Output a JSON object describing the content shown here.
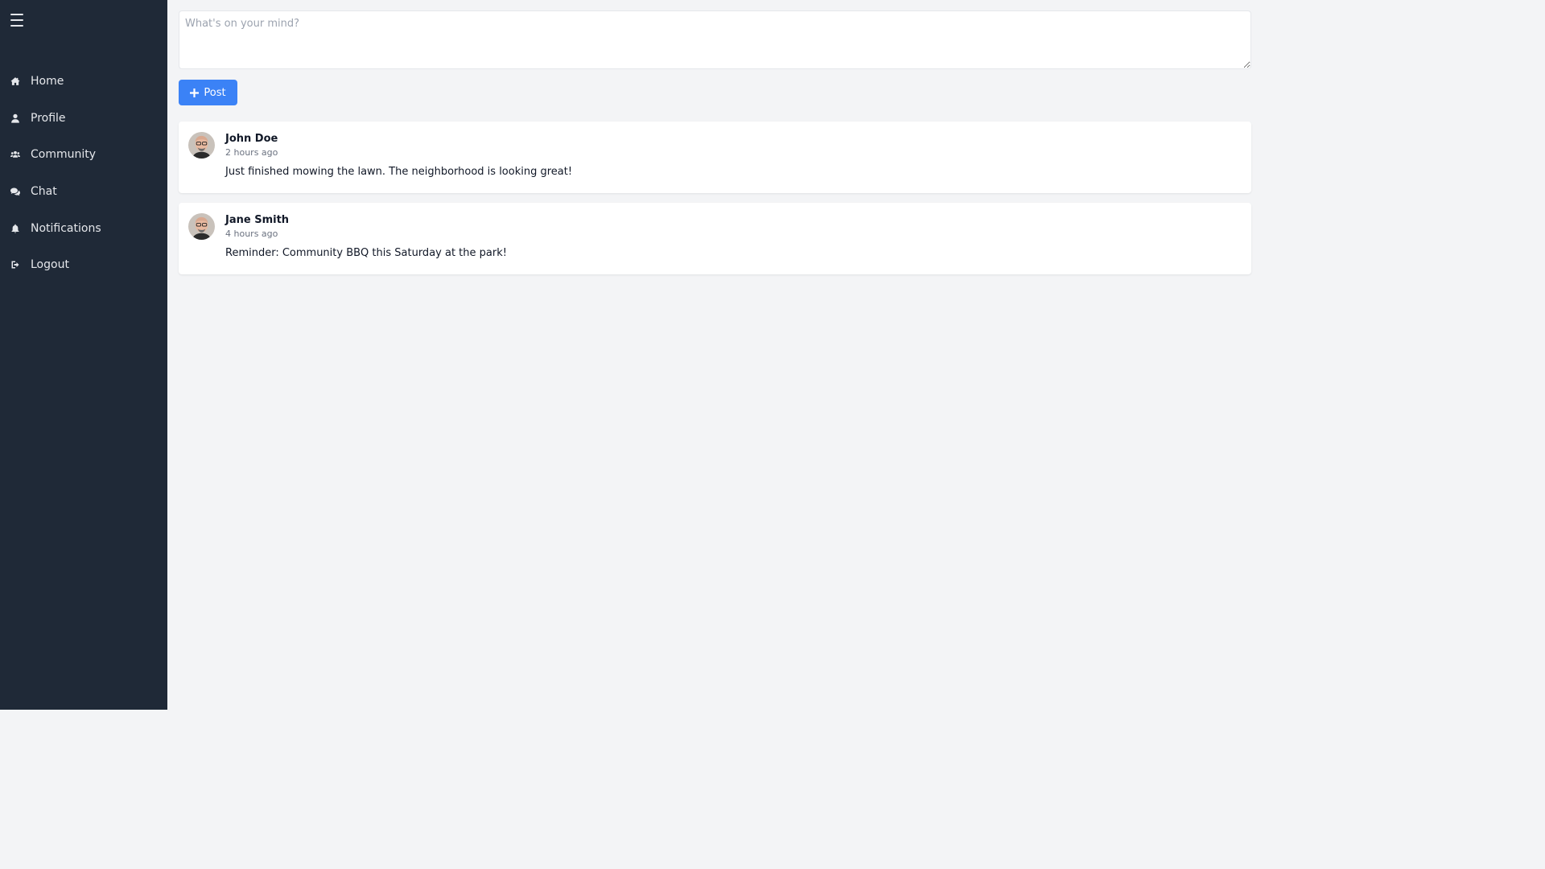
{
  "sidebar": {
    "menu_icon": "hamburger-icon",
    "items": [
      {
        "label": "Home",
        "icon": "home-icon"
      },
      {
        "label": "Profile",
        "icon": "user-icon"
      },
      {
        "label": "Community",
        "icon": "users-icon"
      },
      {
        "label": "Chat",
        "icon": "chat-icon"
      },
      {
        "label": "Notifications",
        "icon": "bell-icon"
      },
      {
        "label": "Logout",
        "icon": "logout-icon"
      }
    ]
  },
  "composer": {
    "placeholder": "What's on your mind?",
    "value": ""
  },
  "post_button": {
    "label": "Post",
    "icon": "plus-icon"
  },
  "posts": [
    {
      "author": "John Doe",
      "time": "2 hours ago",
      "content": "Just finished mowing the lawn. The neighborhood is looking great!"
    },
    {
      "author": "Jane Smith",
      "time": "4 hours ago",
      "content": "Reminder: Community BBQ this Saturday at the park!"
    }
  ],
  "colors": {
    "sidebar_bg": "#1f2937",
    "page_bg": "#f3f4f6",
    "accent": "#3b82f6"
  }
}
